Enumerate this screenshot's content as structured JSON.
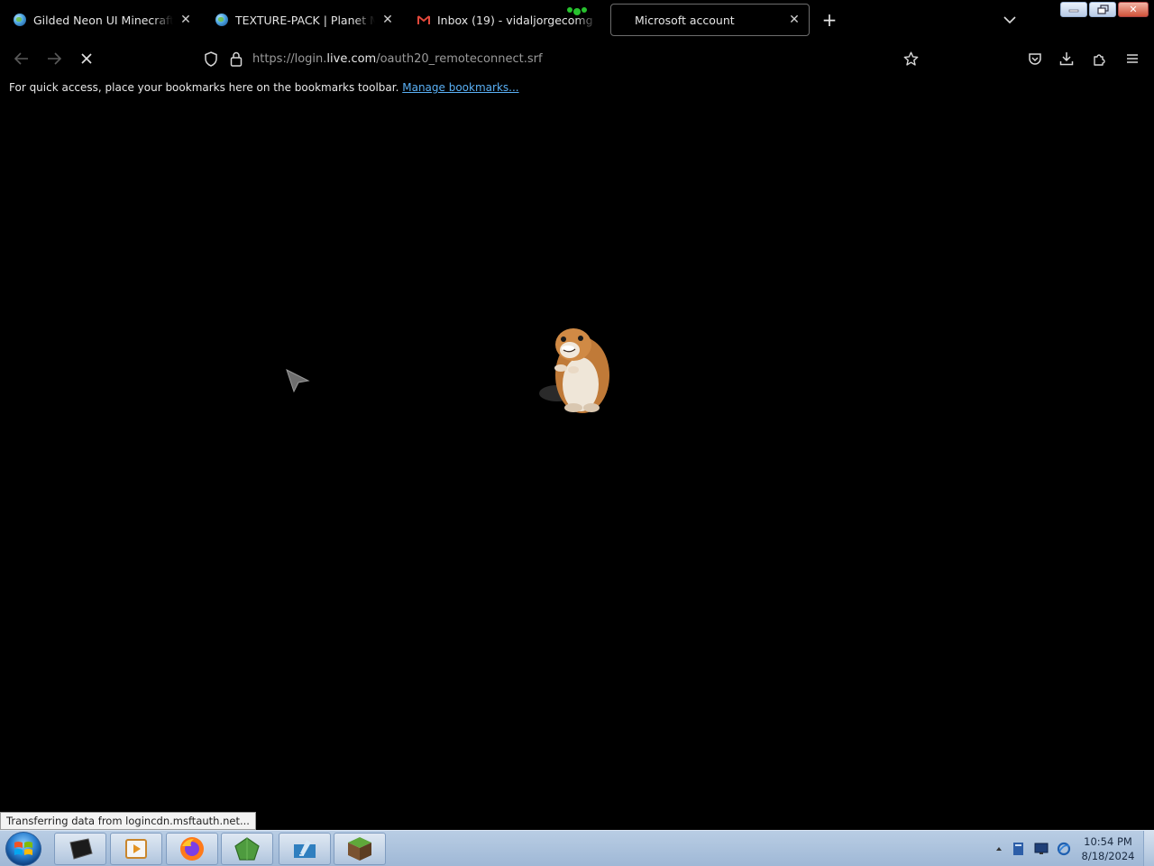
{
  "tabs": [
    {
      "title": "Gilded Neon UI Minecraft Texture Pack",
      "icon": "globe-icon",
      "active": false
    },
    {
      "title": "TEXTURE-PACK | Planet Minecraft",
      "icon": "globe-icon",
      "active": false
    },
    {
      "title": "Inbox (19) - vidaljorgecomg",
      "icon": "gmail-icon",
      "active": false
    },
    {
      "title": "Microsoft account",
      "icon": "loading-icon",
      "active": true
    }
  ],
  "nav": {
    "url_prefix": "https://login.",
    "url_host": "live.com",
    "url_path": "/oauth20_remoteconnect.srf"
  },
  "bookmarks_bar": {
    "message": "For quick access, place your bookmarks here on the bookmarks toolbar.",
    "link": "Manage bookmarks..."
  },
  "status_bar": {
    "text": "Transferring data from logincdn.msftauth.net..."
  },
  "taskbar": {
    "time": "10:54 PM",
    "date": "8/18/2024",
    "apps": [
      "terminal-icon",
      "media-player-icon",
      "firefox-icon",
      "emerald-icon",
      "file-manager-icon",
      "minecraft-grass-block-icon"
    ]
  },
  "colors": {
    "background": "#000000",
    "link": "#5ab0f5",
    "taskbar": "#a9c1dd"
  }
}
